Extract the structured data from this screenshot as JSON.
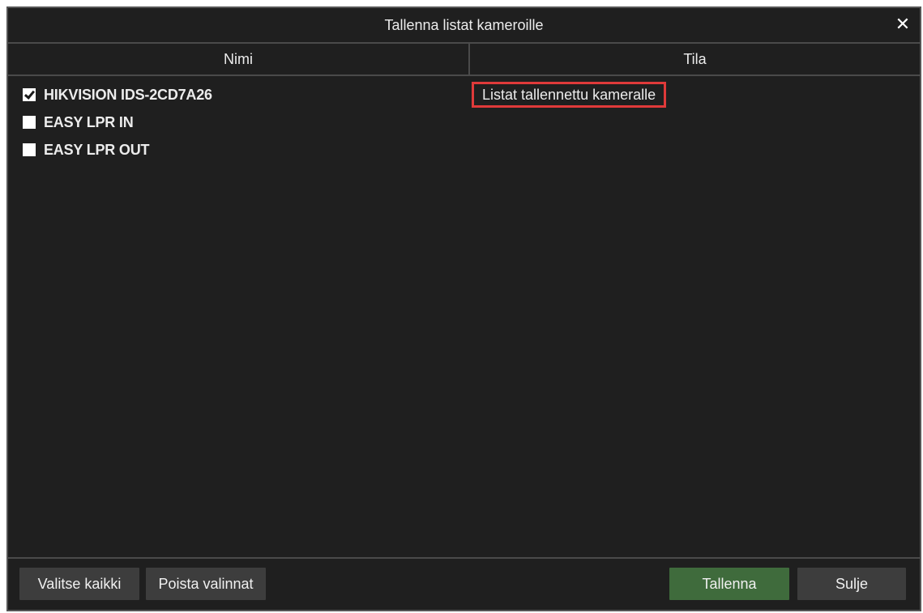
{
  "dialog": {
    "title": "Tallenna listat kameroille",
    "close_glyph": "✕"
  },
  "table": {
    "columns": [
      "Nimi",
      "Tila"
    ],
    "rows": [
      {
        "name": "HIKVISION IDS-2CD7A26",
        "checked": true,
        "status": "Listat tallennettu kameralle"
      },
      {
        "name": "EASY LPR IN",
        "checked": false,
        "status": ""
      },
      {
        "name": "EASY LPR OUT",
        "checked": false,
        "status": ""
      }
    ]
  },
  "footer": {
    "select_all_label": "Valitse kaikki",
    "clear_selection_label": "Poista valinnat",
    "save_label": "Tallenna",
    "close_label": "Sulje"
  },
  "colors": {
    "background": "#1f1f1f",
    "highlight_border": "#e03a3a",
    "save_button": "#3f6b3c",
    "button": "#3d3d3d"
  }
}
